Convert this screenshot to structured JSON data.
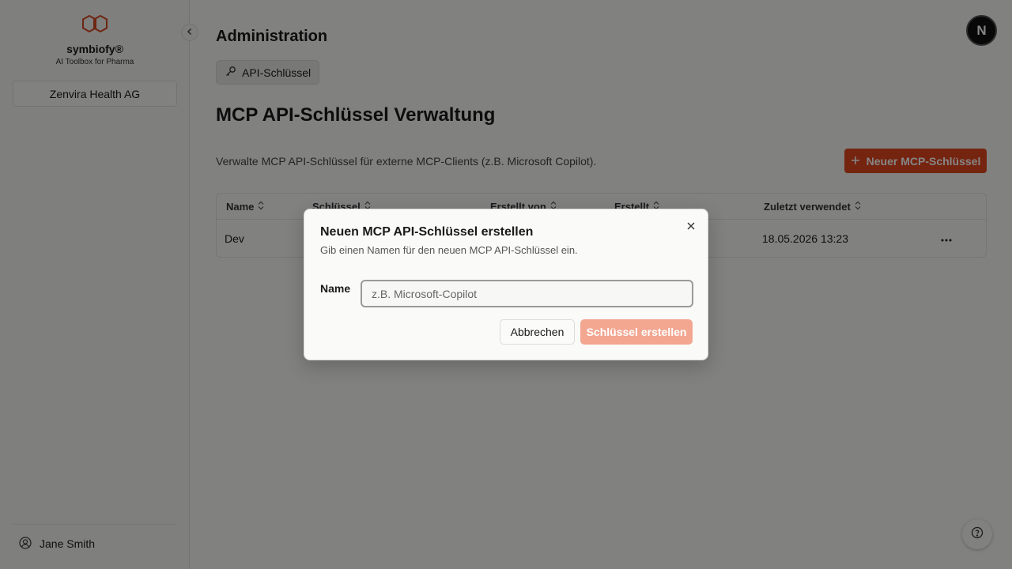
{
  "brand": {
    "name": "symbiofy®",
    "tagline": "AI Toolbox for Pharma"
  },
  "sidebar": {
    "organization": "Zenvira Health AG",
    "user": {
      "name": "Jane Smith"
    }
  },
  "header": {
    "title": "Administration",
    "avatar_initial": "N"
  },
  "tabs": [
    {
      "label": "API-Schlüssel",
      "icon": "key-icon",
      "active": true
    }
  ],
  "main": {
    "title": "MCP API-Schlüssel Verwaltung",
    "description": "Verwalte MCP API-Schlüssel für externe MCP-Clients (z.B. Microsoft Copilot).",
    "new_key_button": "Neuer MCP-Schlüssel"
  },
  "table": {
    "columns": [
      "Name",
      "Schlüssel",
      "Erstellt von",
      "Erstellt",
      "Zuletzt verwendet"
    ],
    "rows": [
      {
        "name": "Dev",
        "last_used": "18.05.2026 13:23"
      }
    ]
  },
  "dialog": {
    "title": "Neuen MCP API-Schlüssel erstellen",
    "description": "Gib einen Namen für den neuen MCP API-Schlüssel ein.",
    "name_label": "Name",
    "name_value": "",
    "name_placeholder": "z.B. Microsoft-Copilot",
    "cancel_label": "Abbrechen",
    "create_label": "Schlüssel erstellen"
  },
  "colors": {
    "accent": "#e0461d",
    "accent_disabled": "#f3a690",
    "overlay": "rgba(0,0,0,0.48)"
  }
}
